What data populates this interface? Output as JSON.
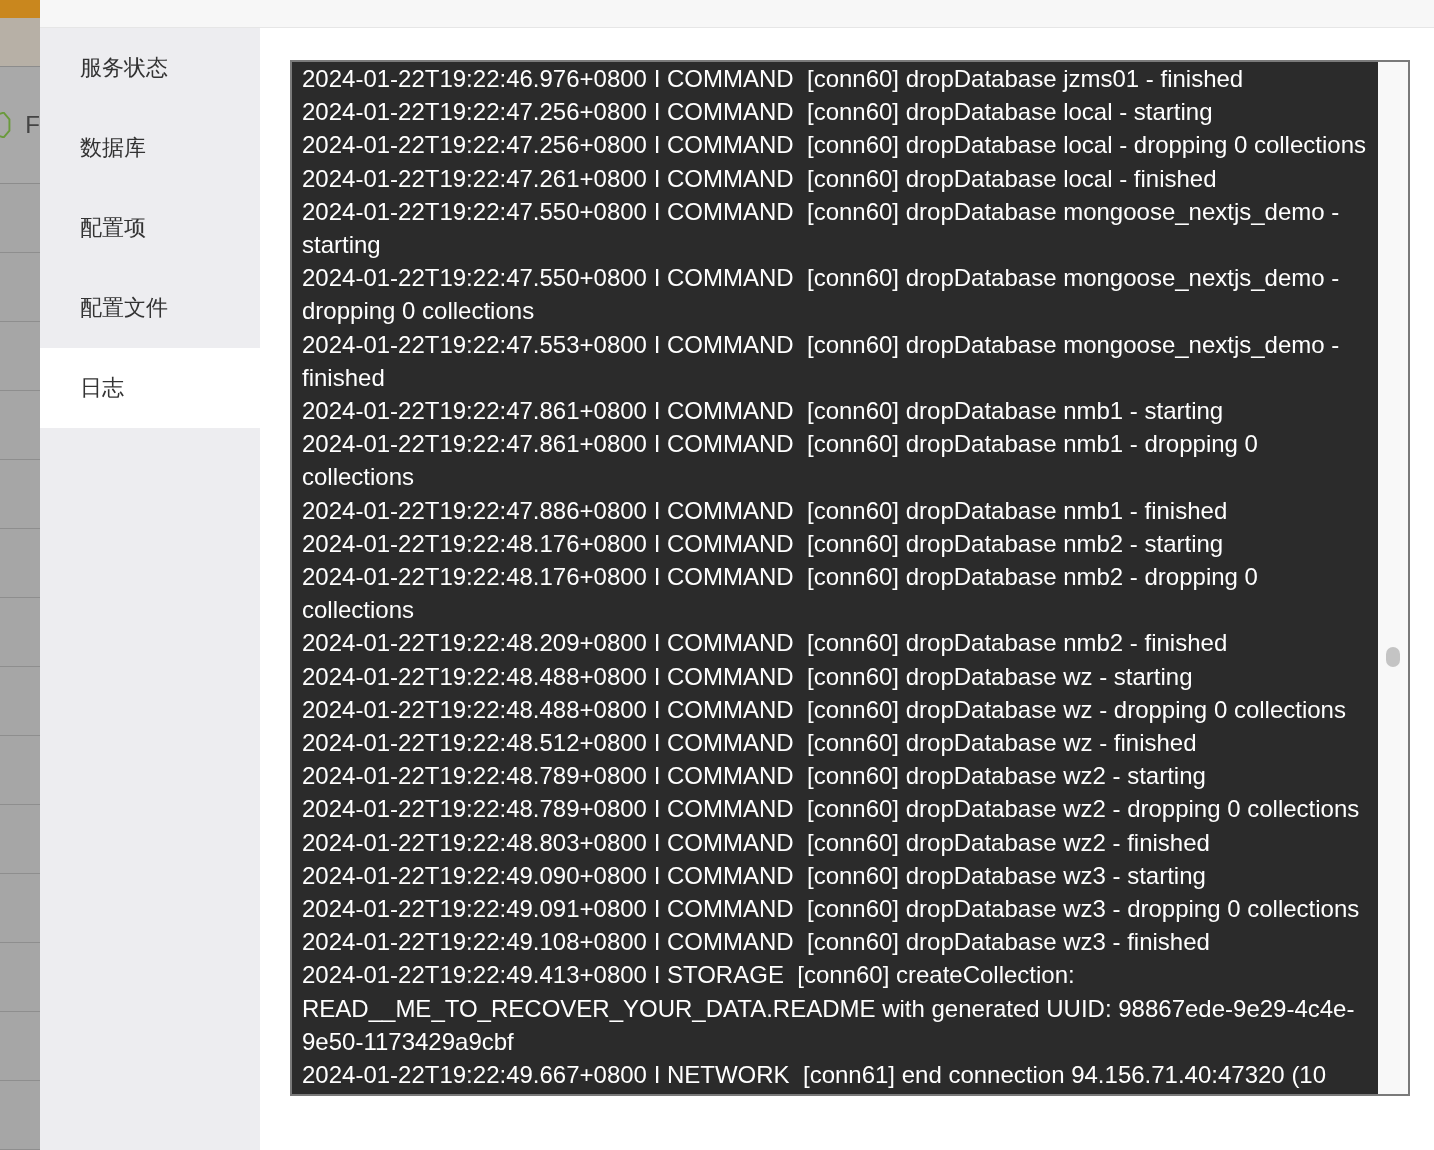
{
  "background_page": {
    "label": "F"
  },
  "sidebar": {
    "items": [
      {
        "label": "服务状态",
        "selected": false
      },
      {
        "label": "数据库",
        "selected": false
      },
      {
        "label": "配置项",
        "selected": false
      },
      {
        "label": "配置文件",
        "selected": false
      },
      {
        "label": "日志",
        "selected": true
      }
    ]
  },
  "log": {
    "lines": [
      "2024-01-22T19:22:46.976+0800 I COMMAND  [conn60] dropDatabase jzms01 - finished",
      "2024-01-22T19:22:47.256+0800 I COMMAND  [conn60] dropDatabase local - starting",
      "2024-01-22T19:22:47.256+0800 I COMMAND  [conn60] dropDatabase local - dropping 0 collections",
      "2024-01-22T19:22:47.261+0800 I COMMAND  [conn60] dropDatabase local - finished",
      "2024-01-22T19:22:47.550+0800 I COMMAND  [conn60] dropDatabase mongoose_nextjs_demo - starting",
      "2024-01-22T19:22:47.550+0800 I COMMAND  [conn60] dropDatabase mongoose_nextjs_demo - dropping 0 collections",
      "2024-01-22T19:22:47.553+0800 I COMMAND  [conn60] dropDatabase mongoose_nextjs_demo - finished",
      "2024-01-22T19:22:47.861+0800 I COMMAND  [conn60] dropDatabase nmb1 - starting",
      "2024-01-22T19:22:47.861+0800 I COMMAND  [conn60] dropDatabase nmb1 - dropping 0 collections",
      "2024-01-22T19:22:47.886+0800 I COMMAND  [conn60] dropDatabase nmb1 - finished",
      "2024-01-22T19:22:48.176+0800 I COMMAND  [conn60] dropDatabase nmb2 - starting",
      "2024-01-22T19:22:48.176+0800 I COMMAND  [conn60] dropDatabase nmb2 - dropping 0 collections",
      "2024-01-22T19:22:48.209+0800 I COMMAND  [conn60] dropDatabase nmb2 - finished",
      "2024-01-22T19:22:48.488+0800 I COMMAND  [conn60] dropDatabase wz - starting",
      "2024-01-22T19:22:48.488+0800 I COMMAND  [conn60] dropDatabase wz - dropping 0 collections",
      "2024-01-22T19:22:48.512+0800 I COMMAND  [conn60] dropDatabase wz - finished",
      "2024-01-22T19:22:48.789+0800 I COMMAND  [conn60] dropDatabase wz2 - starting",
      "2024-01-22T19:22:48.789+0800 I COMMAND  [conn60] dropDatabase wz2 - dropping 0 collections",
      "2024-01-22T19:22:48.803+0800 I COMMAND  [conn60] dropDatabase wz2 - finished",
      "2024-01-22T19:22:49.090+0800 I COMMAND  [conn60] dropDatabase wz3 - starting",
      "2024-01-22T19:22:49.091+0800 I COMMAND  [conn60] dropDatabase wz3 - dropping 0 collections",
      "2024-01-22T19:22:49.108+0800 I COMMAND  [conn60] dropDatabase wz3 - finished",
      "2024-01-22T19:22:49.413+0800 I STORAGE  [conn60] createCollection: READ__ME_TO_RECOVER_YOUR_DATA.README with generated UUID: 98867ede-9e29-4c4e-9e50-1173429a9cbf",
      "2024-01-22T19:22:49.667+0800 I NETWORK  [conn61] end connection 94.156.71.40:47320 (10"
    ]
  }
}
